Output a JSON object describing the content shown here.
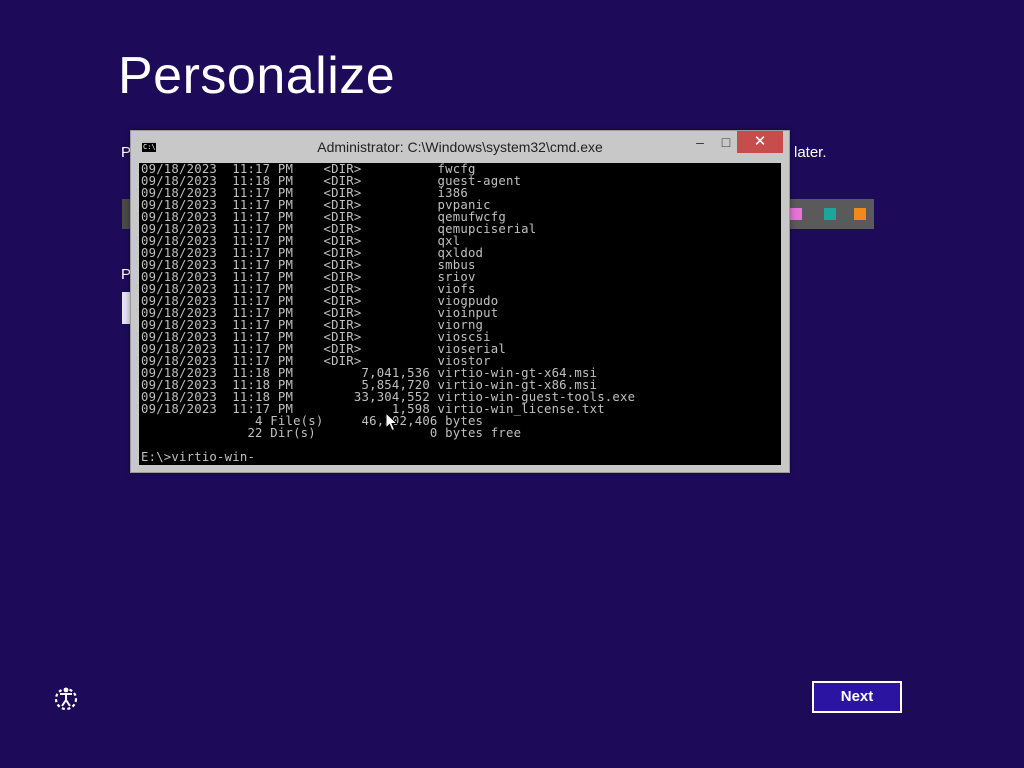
{
  "page": {
    "title": "Personalize",
    "left_text_1": "P",
    "left_text_2": "P",
    "later_text": "later."
  },
  "colors": {
    "background": "#1d0b5a",
    "accent_pink": "#e573d8",
    "accent_teal": "#1fa49c",
    "accent_orange": "#f08a1c"
  },
  "cmd": {
    "title": "Administrator: C:\\Windows\\system32\\cmd.exe",
    "icon_text": "C:\\",
    "minimize": "–",
    "maximize": "□",
    "close": "✕",
    "lines": [
      "09/18/2023  11:17 PM    <DIR>          fwcfg",
      "09/18/2023  11:18 PM    <DIR>          guest-agent",
      "09/18/2023  11:17 PM    <DIR>          i386",
      "09/18/2023  11:17 PM    <DIR>          pvpanic",
      "09/18/2023  11:17 PM    <DIR>          qemufwcfg",
      "09/18/2023  11:17 PM    <DIR>          qemupciserial",
      "09/18/2023  11:17 PM    <DIR>          qxl",
      "09/18/2023  11:17 PM    <DIR>          qxldod",
      "09/18/2023  11:17 PM    <DIR>          smbus",
      "09/18/2023  11:17 PM    <DIR>          sriov",
      "09/18/2023  11:17 PM    <DIR>          viofs",
      "09/18/2023  11:17 PM    <DIR>          viogpudo",
      "09/18/2023  11:17 PM    <DIR>          vioinput",
      "09/18/2023  11:17 PM    <DIR>          viorng",
      "09/18/2023  11:17 PM    <DIR>          vioscsi",
      "09/18/2023  11:17 PM    <DIR>          vioserial",
      "09/18/2023  11:17 PM    <DIR>          viostor",
      "09/18/2023  11:18 PM         7,041,536 virtio-win-gt-x64.msi",
      "09/18/2023  11:18 PM         5,854,720 virtio-win-gt-x86.msi",
      "09/18/2023  11:18 PM        33,304,552 virtio-win-guest-tools.exe",
      "09/18/2023  11:17 PM             1,598 virtio-win_license.txt",
      "               4 File(s)     46,202,406 bytes",
      "              22 Dir(s)               0 bytes free"
    ],
    "prompt": "E:\\>virtio-win-"
  },
  "footer": {
    "ease_icon": "ease-of-access-icon",
    "next_label": "Next"
  }
}
